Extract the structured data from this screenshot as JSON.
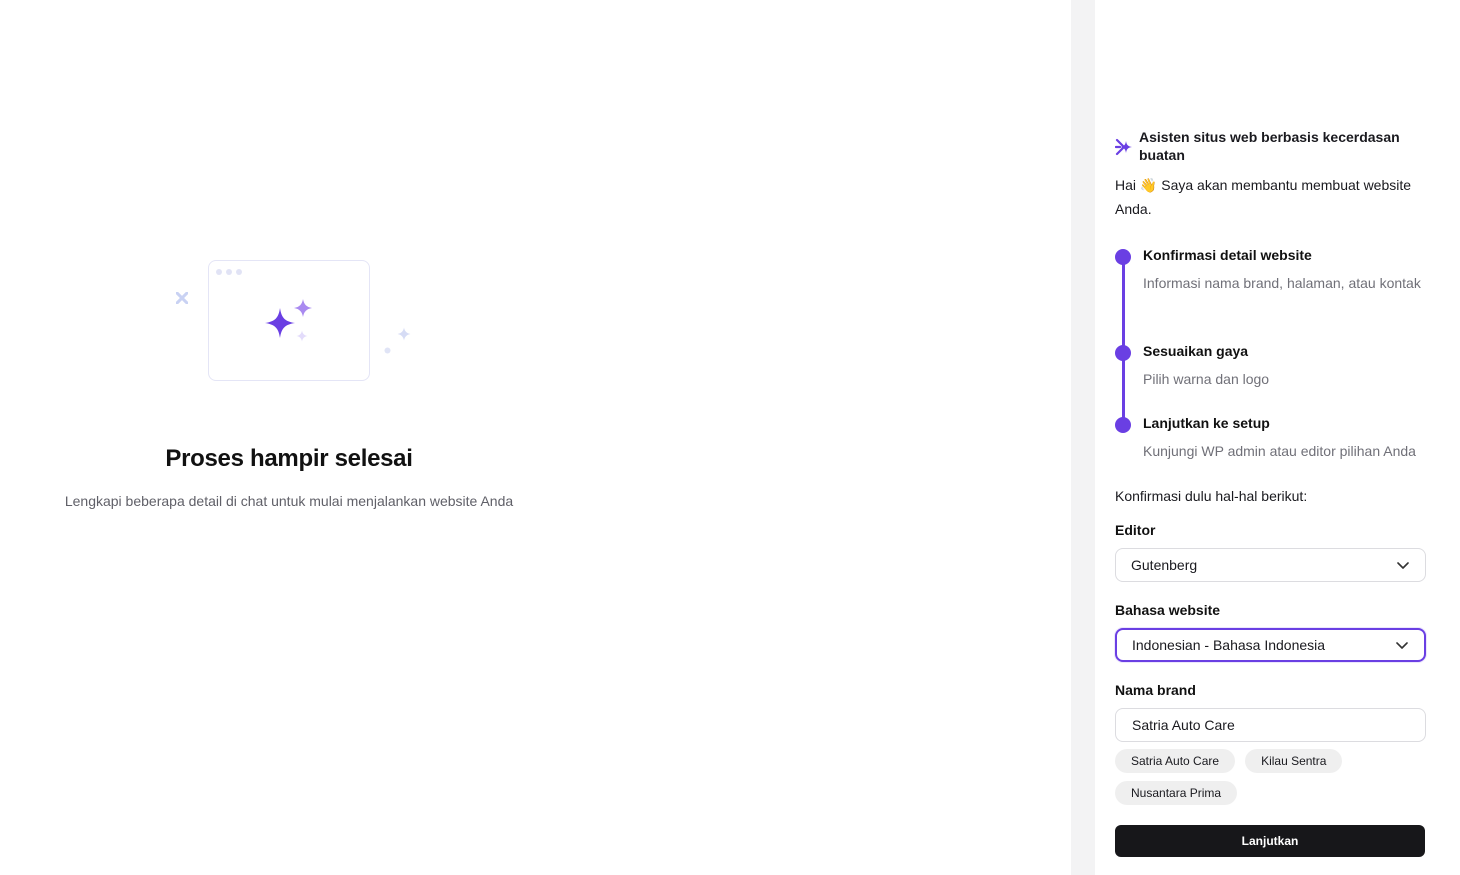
{
  "main": {
    "title": "Proses hampir selesai",
    "subtitle": "Lengkapi beberapa detail di chat untuk mulai menjalankan website Anda"
  },
  "assistant": {
    "header_title": "Asisten situs web berbasis kecerdasan buatan",
    "greeting_prefix": "Hai",
    "greeting_emoji": "👋",
    "greeting_text": "Saya akan membantu membuat website Anda.",
    "steps": [
      {
        "title": "Konfirmasi detail website",
        "description": "Informasi nama brand, halaman, atau kontak"
      },
      {
        "title": "Sesuaikan gaya",
        "description": "Pilih warna dan logo"
      },
      {
        "title": "Lanjutkan ke setup",
        "description": "Kunjungi WP admin atau editor pilihan Anda"
      }
    ],
    "confirm_text": "Konfirmasi dulu hal-hal berikut:"
  },
  "form": {
    "editor_label": "Editor",
    "editor_value": "Gutenberg",
    "language_label": "Bahasa website",
    "language_value": "Indonesian - Bahasa Indonesia",
    "brand_label": "Nama brand",
    "brand_value": "Satria Auto Care",
    "suggestions": [
      "Satria Auto Care",
      "Kilau Sentra",
      "Nusantara Prima"
    ],
    "submit_label": "Lanjutkan"
  },
  "icons": {
    "assistant_logo": "ai-sparkle-logo-icon",
    "dropdown": "chevron-down-icon",
    "illustration": "sparkles-window-illustration"
  },
  "colors": {
    "accent": "#6a3fe3",
    "button_bg": "#17171a",
    "chip_bg": "#efefef"
  }
}
